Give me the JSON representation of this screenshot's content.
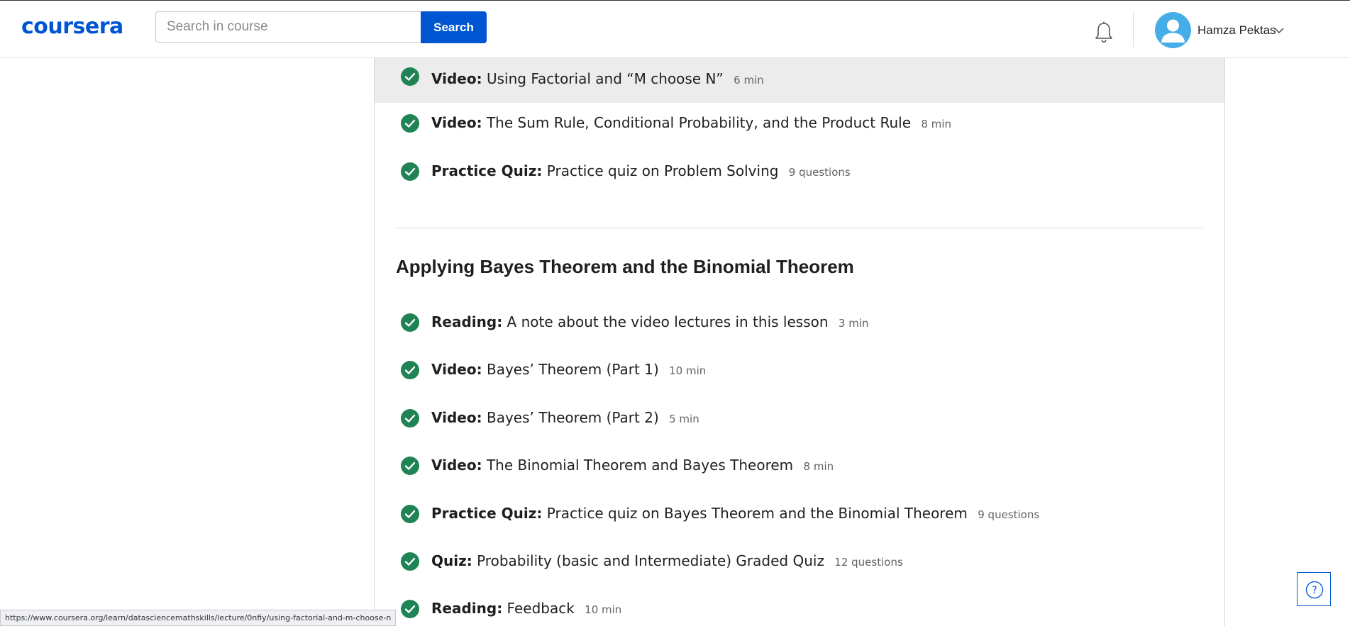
{
  "header": {
    "logo": "coursera",
    "search_placeholder": "Search in course",
    "search_button": "Search",
    "user_name": "Hamza Pektas"
  },
  "lesson_items_top": [
    {
      "type": "Video:",
      "title": "Using Factorial and “M choose N”",
      "meta": "6 min",
      "completed": true
    },
    {
      "type": "Video:",
      "title": "The Sum Rule, Conditional Probability, and the Product Rule",
      "meta": "8 min",
      "completed": true
    },
    {
      "type": "Practice Quiz:",
      "title": "Practice quiz on Problem Solving",
      "meta": "9 questions",
      "completed": true
    }
  ],
  "section": {
    "title": "Applying Bayes Theorem and the Binomial Theorem",
    "items": [
      {
        "type": "Reading:",
        "title": "A note about the video lectures in this lesson",
        "meta": "3 min",
        "completed": true
      },
      {
        "type": "Video:",
        "title": "Bayes’ Theorem (Part 1)",
        "meta": "10 min",
        "completed": true
      },
      {
        "type": "Video:",
        "title": "Bayes’ Theorem (Part 2)",
        "meta": "5 min",
        "completed": true
      },
      {
        "type": "Video:",
        "title": "The Binomial Theorem and Bayes Theorem",
        "meta": "8 min",
        "completed": true
      },
      {
        "type": "Practice Quiz:",
        "title": "Practice quiz on Bayes Theorem and the Binomial Theorem",
        "meta": "9 questions",
        "completed": true
      },
      {
        "type": "Quiz:",
        "title": "Probability (basic and Intermediate) Graded Quiz",
        "meta": "12 questions",
        "completed": true
      },
      {
        "type": "Reading:",
        "title": "Feedback",
        "meta": "10 min",
        "completed": true
      }
    ]
  },
  "status_bar": {
    "url": "https://www.coursera.org/learn/datasciencemathskills/lecture/0nfiy/using-factorial-and-m-choose-n"
  },
  "help": {
    "label": "?"
  },
  "colors": {
    "brand": "#0056d2",
    "check_green": "#1f8354",
    "hover_row": "#ececec"
  },
  "icons": [
    "bell-icon",
    "avatar-user-icon",
    "chevron-down-icon",
    "check-circle-icon",
    "help-icon"
  ]
}
